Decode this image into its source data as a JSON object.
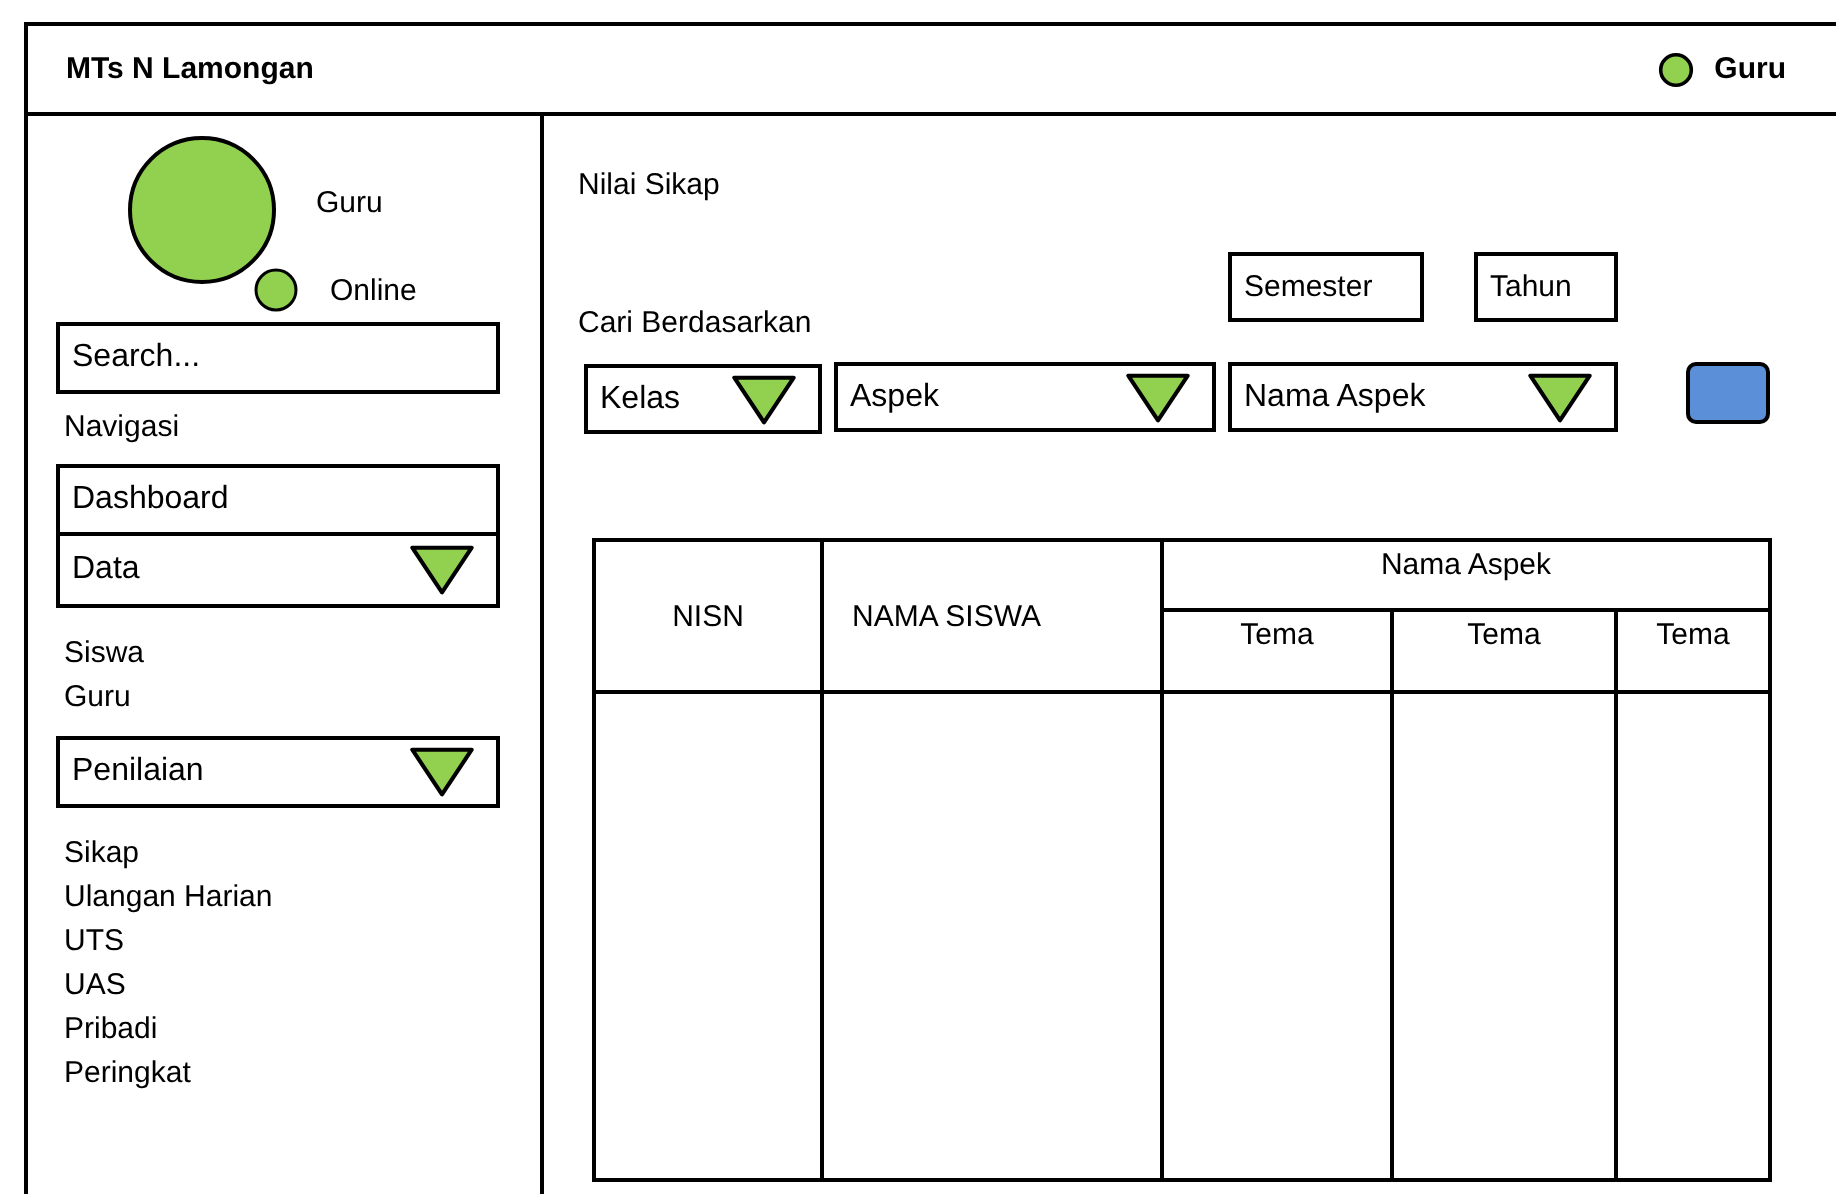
{
  "header": {
    "title": "MTs N Lamongan",
    "user": "Guru"
  },
  "sidebar": {
    "profile": {
      "name": "Guru",
      "status": "Online"
    },
    "search": {
      "placeholder": "Search..."
    },
    "nav_heading": "Navigasi",
    "nav": [
      {
        "kind": "link",
        "label": "Dashboard"
      },
      {
        "kind": "dropdown",
        "label": "Data",
        "expanded": true,
        "children": [
          {
            "label": "Siswa"
          },
          {
            "label": "Guru"
          }
        ]
      },
      {
        "kind": "dropdown",
        "label": "Penilaian",
        "expanded": true,
        "children": [
          {
            "label": "Sikap"
          },
          {
            "label": "Ulangan Harian"
          },
          {
            "label": "UTS"
          },
          {
            "label": "UAS"
          },
          {
            "label": "Pribadi"
          },
          {
            "label": "Peringkat"
          }
        ]
      }
    ]
  },
  "main": {
    "title": "Nilai Sikap",
    "filter_label": "Cari Berdasarkan",
    "period_fields": [
      {
        "label": "Semester"
      },
      {
        "label": "Tahun"
      }
    ],
    "filters": [
      {
        "label": "Kelas"
      },
      {
        "label": "Aspek"
      },
      {
        "label": "Nama Aspek"
      }
    ],
    "table": {
      "columns": [
        "NISN",
        "NAMA SISWA"
      ],
      "group": {
        "label": "Nama Aspek",
        "columns": [
          "Tema",
          "Tema",
          "Tema"
        ]
      }
    }
  }
}
